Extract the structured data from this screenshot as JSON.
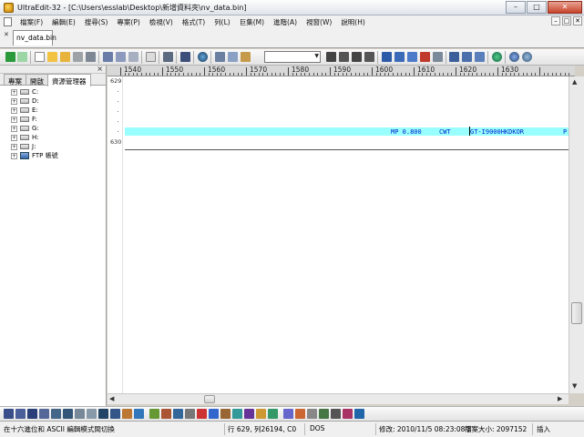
{
  "window": {
    "title": "UltraEdit-32 - [C:\\Users\\esslab\\Desktop\\新增資料夾\\nv_data.bin]",
    "minimize": "–",
    "maximize": "□",
    "close": "✕"
  },
  "menu": {
    "items": [
      "檔案(F)",
      "編輯(E)",
      "搜尋(S)",
      "專案(P)",
      "檢視(V)",
      "格式(T)",
      "列(L)",
      "巨集(M)",
      "進階(A)",
      "視窗(W)",
      "說明(H)"
    ],
    "mdi_buttons": [
      "–",
      "□",
      "✕"
    ]
  },
  "tabs": {
    "close_x": "✕",
    "file_tab": "nv_data.bin"
  },
  "toolbar": {
    "combo_value": "",
    "combo_arrow": "▼"
  },
  "sidepane": {
    "close": "×",
    "tabs": [
      "專案",
      "開啟",
      "資源管理器"
    ],
    "active_tab": 2,
    "tree": [
      {
        "label": "C:",
        "icon": "drive-icon"
      },
      {
        "label": "D:",
        "icon": "drive-icon"
      },
      {
        "label": "E:",
        "icon": "drive-icon"
      },
      {
        "label": "F:",
        "icon": "drive-icon"
      },
      {
        "label": "G:",
        "icon": "drive-icon"
      },
      {
        "label": "H:",
        "icon": "drive-icon"
      },
      {
        "label": "J:",
        "icon": "drive-icon"
      },
      {
        "label": "FTP 帳號",
        "icon": "ftp-icon"
      }
    ]
  },
  "ruler": {
    "labels": [
      "1540",
      "1550",
      "1560",
      "1570",
      "1580",
      "1590",
      "1600",
      "1610",
      "1620",
      "1630"
    ]
  },
  "editor": {
    "line_numbers": [
      "629",
      "630"
    ],
    "highlight_segments": [
      {
        "text": "MP 0.800",
        "col": 0
      },
      {
        "text": "CWT",
        "col": 1
      },
      {
        "text": "GT-I9000HKDKOR",
        "col": 2
      },
      {
        "text": "P",
        "col": 3
      }
    ],
    "highlight_color": "#99ffff",
    "text_color": "#0022cc"
  },
  "scrollbars": {
    "up": "▲",
    "down": "▼",
    "left": "◀",
    "right": "▶"
  },
  "statusbar": {
    "hint": "在十六進位和 ASCII 編輯模式間切換",
    "position": "行 629, 列26194, C0",
    "format": "DOS",
    "modified": "修改: 2010/11/5 08:23:08下",
    "filesize": "檔案大小: 2097152",
    "mode": "插入"
  }
}
